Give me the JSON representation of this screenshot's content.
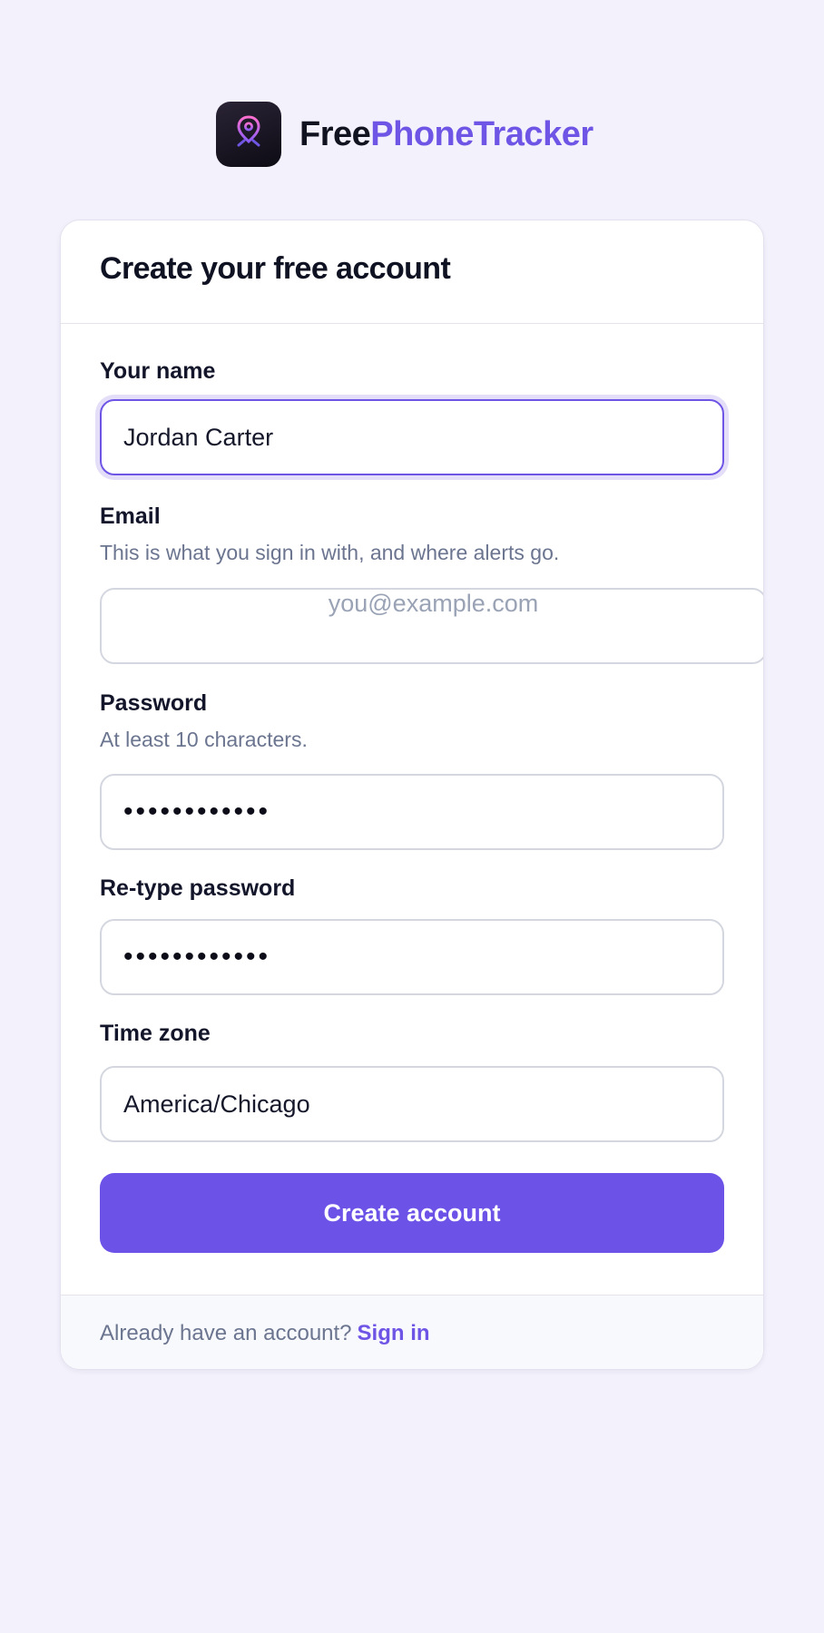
{
  "brand": {
    "name_part1": "Free",
    "name_part2": "PhoneTracker",
    "logo_icon": "map-pin-icon",
    "accent_color": "#6f55e6"
  },
  "form": {
    "title": "Create your free account",
    "name": {
      "label": "Your name",
      "value": "Jordan Carter"
    },
    "email": {
      "label": "Email",
      "hint": "This is what you sign in with, and where alerts go.",
      "placeholder": "you@example.com",
      "value": ""
    },
    "password": {
      "label": "Password",
      "hint": "At least 10 characters.",
      "masked_value": "••••••••••••"
    },
    "retype_password": {
      "label": "Re-type password",
      "masked_value": "••••••••••••"
    },
    "timezone": {
      "label": "Time zone",
      "value": "America/Chicago"
    },
    "submit_label": "Create account"
  },
  "footer": {
    "prompt": "Already have an account?",
    "signin_label": "Sign in"
  },
  "colors": {
    "background": "#f3f1fb",
    "primary_button": "#6d52e8"
  }
}
